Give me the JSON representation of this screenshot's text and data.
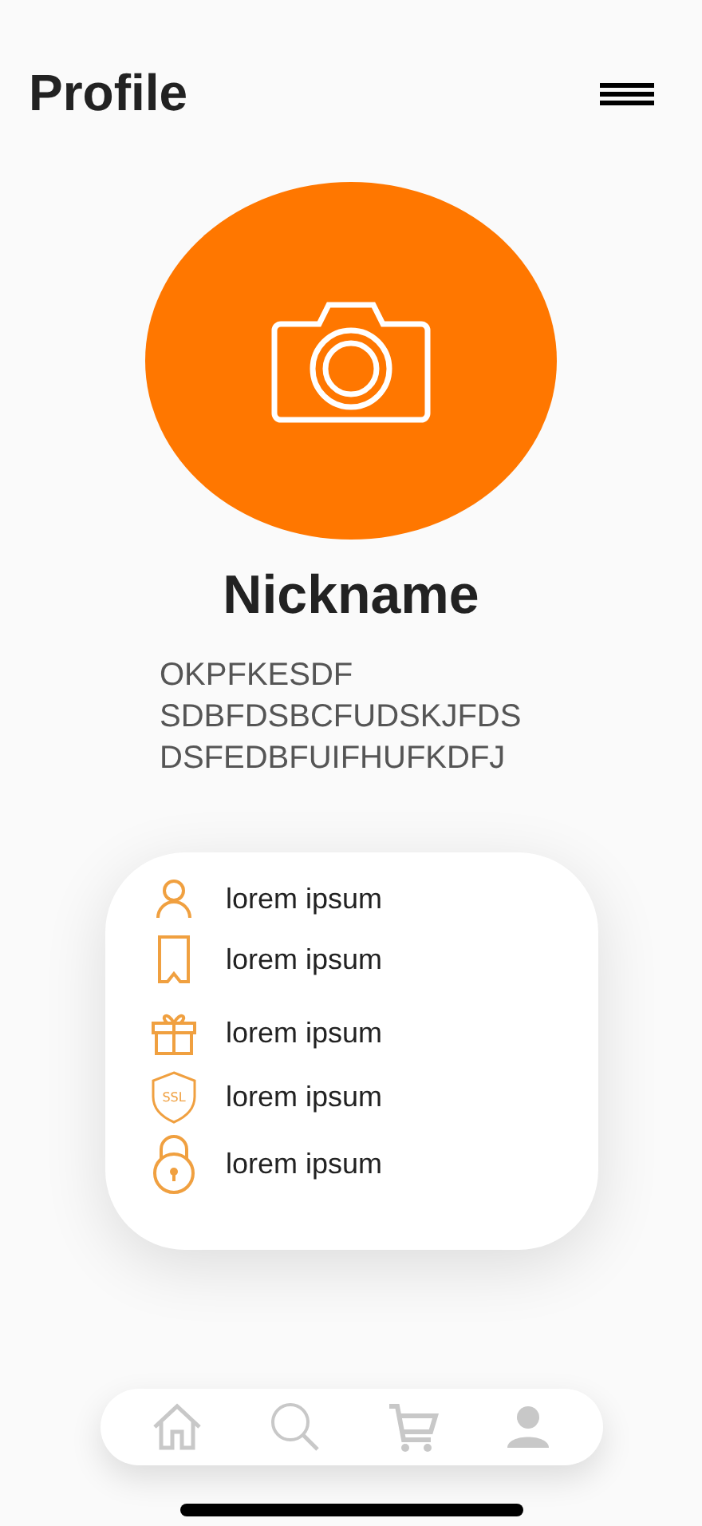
{
  "header": {
    "title": "Profile"
  },
  "profile": {
    "nickname": "Nickname",
    "bio": [
      "OKPFKESDF",
      "SDBFDSBCFUDSKJFDS",
      "DSFEDBFUIFHUFKDFJ"
    ]
  },
  "menu": [
    {
      "kind": "person",
      "label": "lorem ipsum"
    },
    {
      "kind": "bookmark",
      "label": "lorem ipsum"
    },
    {
      "kind": "gift",
      "label": "lorem ipsum"
    },
    {
      "kind": "shield",
      "icon_text": "SSL",
      "label": "lorem ipsum"
    },
    {
      "kind": "lock",
      "label": "lorem ipsum"
    }
  ],
  "nav": [
    {
      "kind": "home"
    },
    {
      "kind": "search"
    },
    {
      "kind": "cart"
    },
    {
      "kind": "person"
    }
  ]
}
